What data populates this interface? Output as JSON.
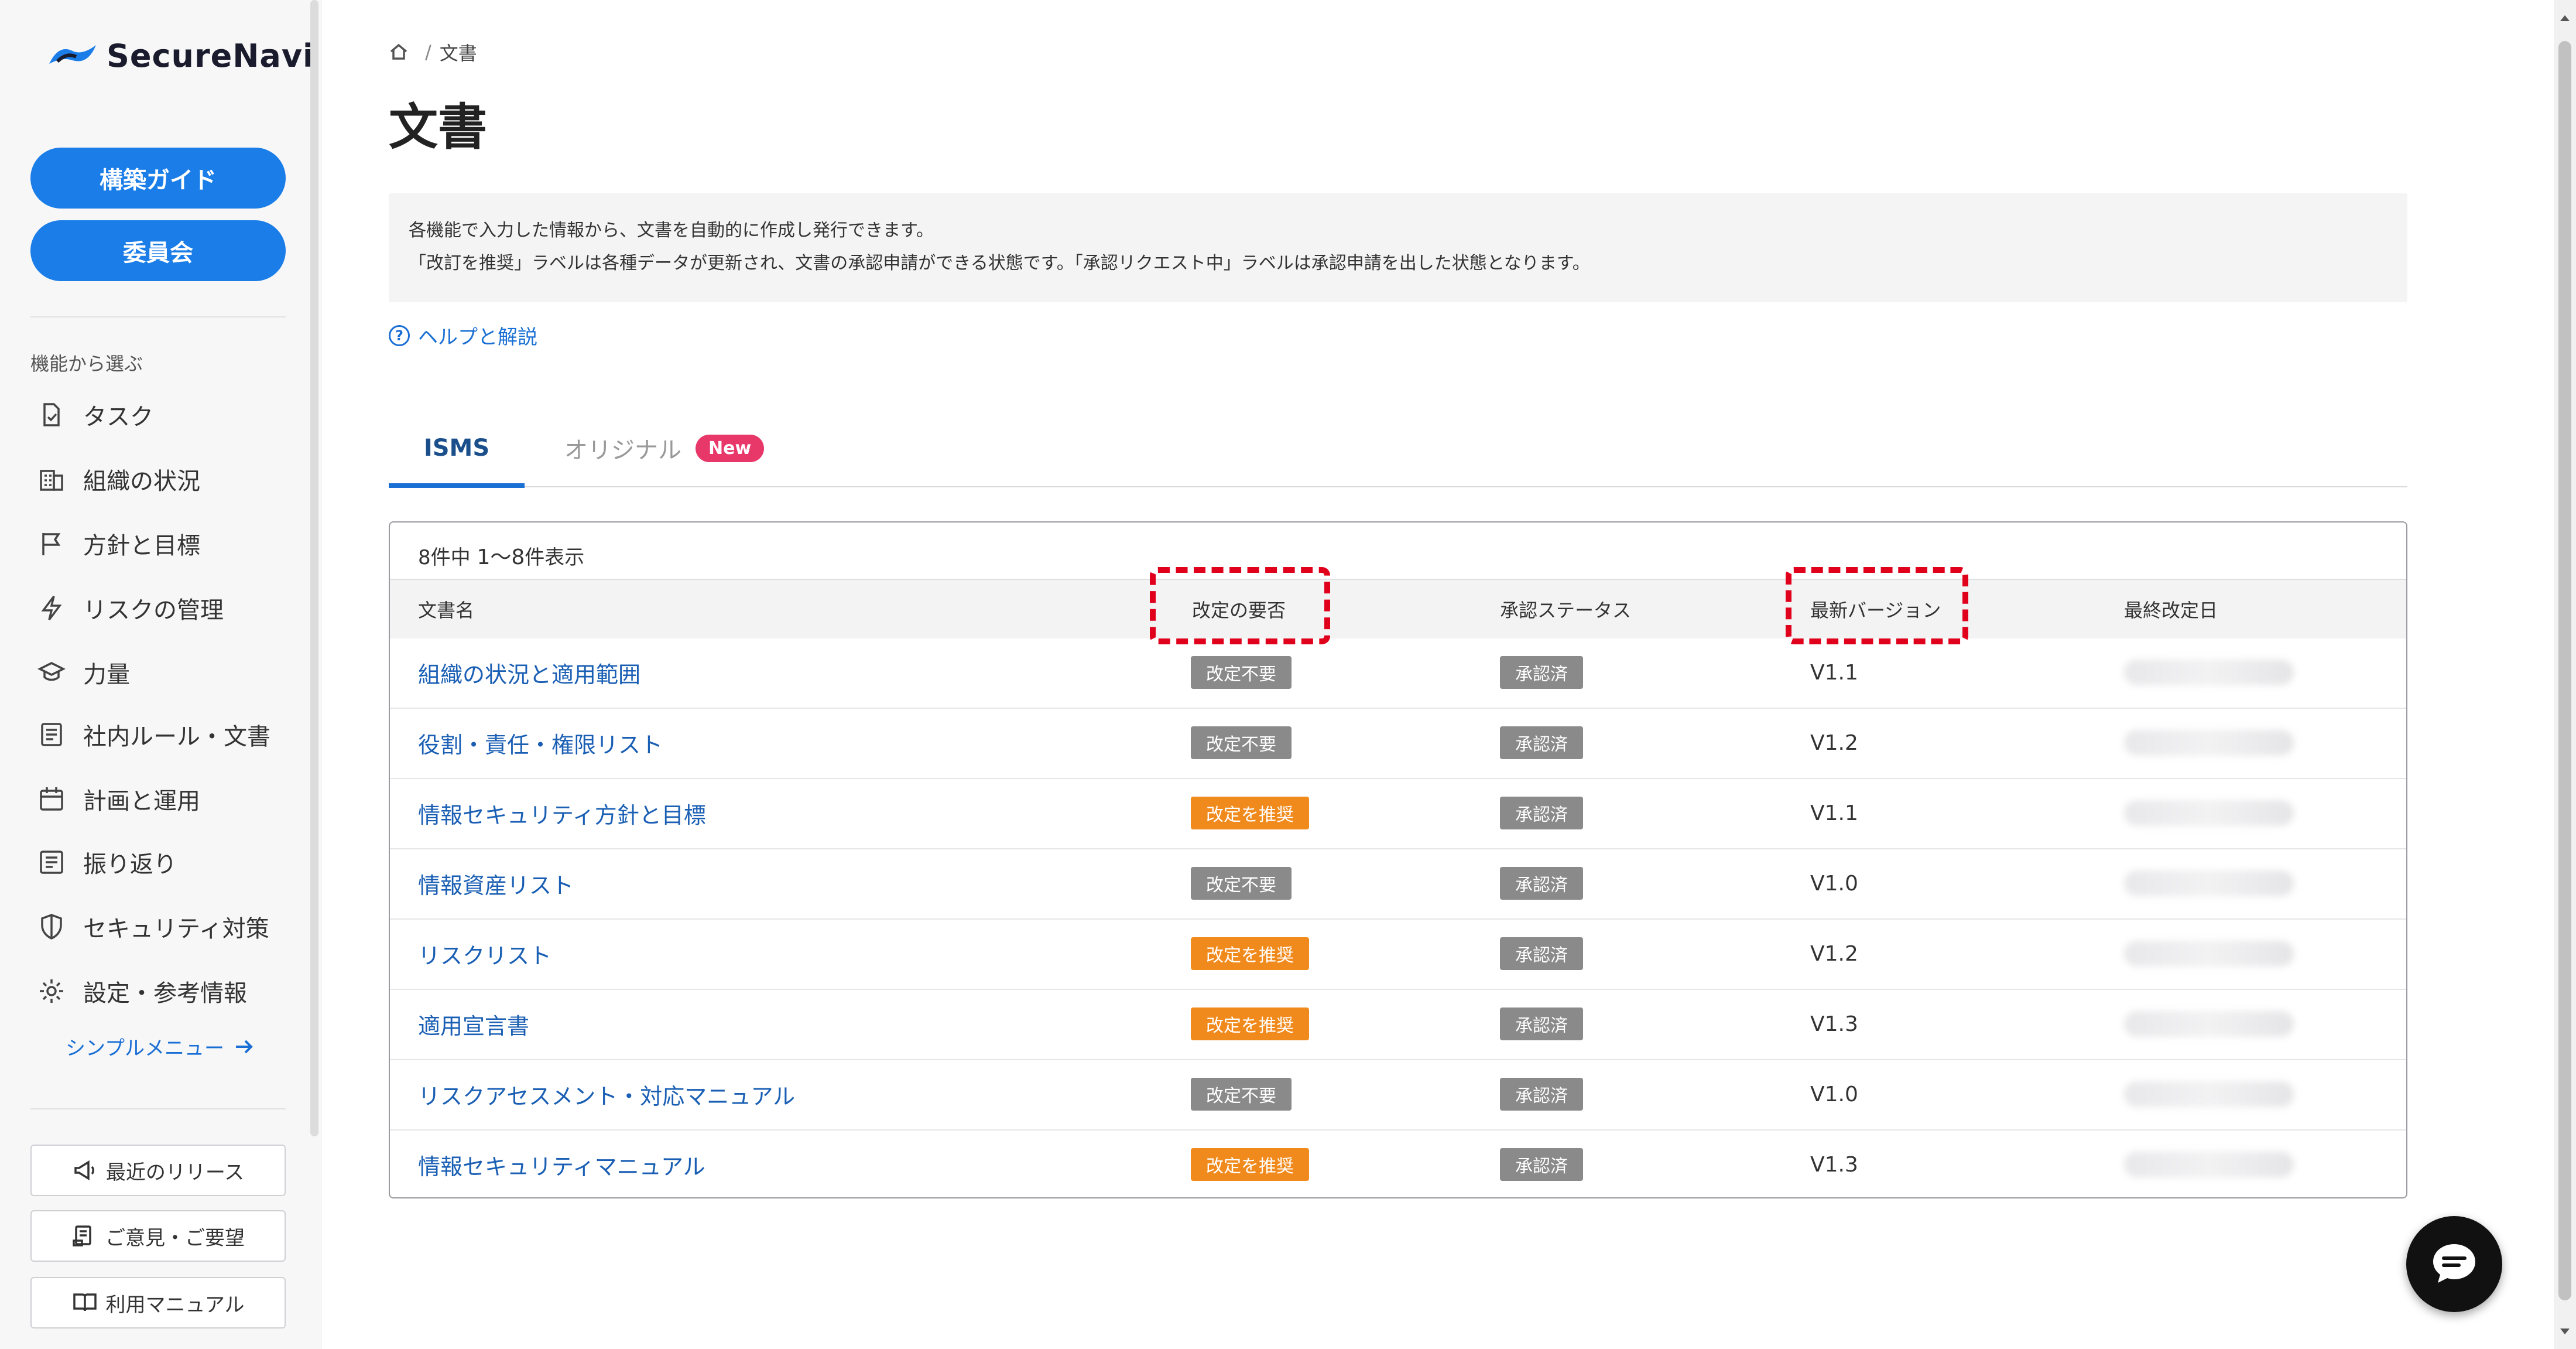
{
  "brand": {
    "name": "SecureNavi"
  },
  "sidebar": {
    "primary_buttons": [
      "構築ガイド",
      "委員会"
    ],
    "section_label": "機能から選ぶ",
    "items": [
      {
        "label": "タスク",
        "icon": "task-icon"
      },
      {
        "label": "組織の状況",
        "icon": "building-icon"
      },
      {
        "label": "方針と目標",
        "icon": "flag-icon"
      },
      {
        "label": "リスクの管理",
        "icon": "bolt-icon"
      },
      {
        "label": "力量",
        "icon": "graduation-cap-icon"
      },
      {
        "label": "社内ルール・文書",
        "icon": "document-icon"
      },
      {
        "label": "計画と運用",
        "icon": "calendar-icon"
      },
      {
        "label": "振り返り",
        "icon": "review-icon"
      },
      {
        "label": "セキュリティ対策",
        "icon": "shield-icon"
      },
      {
        "label": "設定・参考情報",
        "icon": "gear-icon"
      }
    ],
    "simple_menu": "シンプルメニュー",
    "footer_buttons": [
      {
        "label": "最近のリリース",
        "icon": "megaphone-icon"
      },
      {
        "label": "ご意見・ご要望",
        "icon": "feedback-icon"
      },
      {
        "label": "利用マニュアル",
        "icon": "book-icon"
      }
    ]
  },
  "breadcrumb": {
    "current": "文書"
  },
  "page": {
    "title": "文書",
    "info_line1": "各機能で入力した情報から、文書を自動的に作成し発行できます。",
    "info_line2": "「改訂を推奨」ラベルは各種データが更新され、文書の承認申請ができる状態です。「承認リクエスト中」ラベルは承認申請を出した状態となります。",
    "help_link": "ヘルプと解説"
  },
  "tabs": [
    {
      "label": "ISMS",
      "active": true
    },
    {
      "label": "オリジナル",
      "active": false,
      "badge": "New"
    }
  ],
  "table": {
    "count_prefix": "8件中",
    "count_range": "1〜8",
    "count_suffix": "件表示",
    "columns": [
      "文書名",
      "改定の要否",
      "承認ステータス",
      "最新バージョン",
      "最終改定日"
    ],
    "rows": [
      {
        "name": "組織の状況と適用範囲",
        "revision": "改定不要",
        "revision_type": "gray",
        "status": "承認済",
        "version": "V1.1"
      },
      {
        "name": "役割・責任・権限リスト",
        "revision": "改定不要",
        "revision_type": "gray",
        "status": "承認済",
        "version": "V1.2"
      },
      {
        "name": "情報セキュリティ方針と目標",
        "revision": "改定を推奨",
        "revision_type": "orange",
        "status": "承認済",
        "version": "V1.1"
      },
      {
        "name": "情報資産リスト",
        "revision": "改定不要",
        "revision_type": "gray",
        "status": "承認済",
        "version": "V1.0"
      },
      {
        "name": "リスクリスト",
        "revision": "改定を推奨",
        "revision_type": "orange",
        "status": "承認済",
        "version": "V1.2"
      },
      {
        "name": "適用宣言書",
        "revision": "改定を推奨",
        "revision_type": "orange",
        "status": "承認済",
        "version": "V1.3"
      },
      {
        "name": "リスクアセスメント・対応マニュアル",
        "revision": "改定不要",
        "revision_type": "gray",
        "status": "承認済",
        "version": "V1.0"
      },
      {
        "name": "情報セキュリティマニュアル",
        "revision": "改定を推奨",
        "revision_type": "orange",
        "status": "承認済",
        "version": "V1.3"
      }
    ]
  },
  "colors": {
    "primary": "#1a7de8",
    "link": "#1a5fb4",
    "badge_gray": "#8a8a8a",
    "badge_orange": "#f18a1c",
    "new_badge": "#e8386a",
    "highlight": "#e0001b"
  }
}
